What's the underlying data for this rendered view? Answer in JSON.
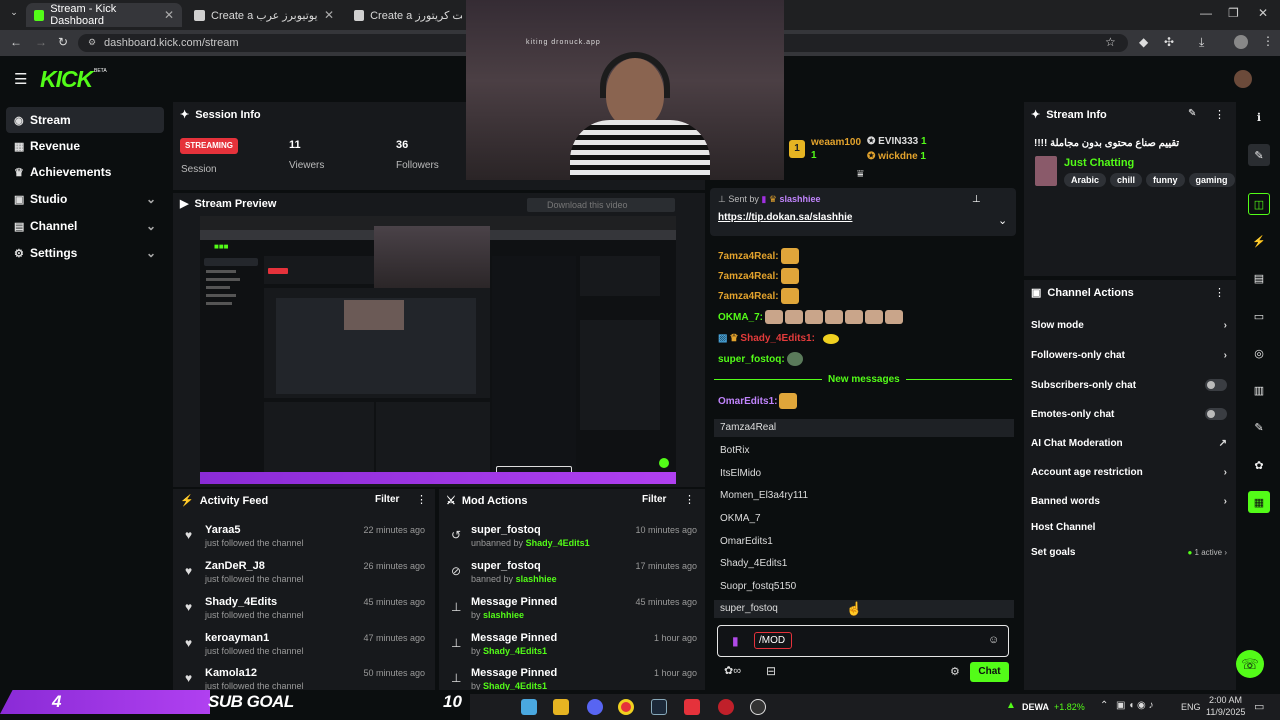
{
  "browser": {
    "tabs": [
      {
        "title": "Stream - Kick Dashboard"
      },
      {
        "title": "Create a تقييم يوتيوبرز عرب Tier"
      },
      {
        "title": "Create a كوست كريتورز Tier"
      }
    ],
    "url": "dashboard.kick.com/stream"
  },
  "brand": {
    "logo": "KICK",
    "beta": "BETA"
  },
  "sidebar": {
    "items": [
      {
        "label": "Stream"
      },
      {
        "label": "Revenue"
      },
      {
        "label": "Achievements"
      },
      {
        "label": "Studio"
      },
      {
        "label": "Channel"
      },
      {
        "label": "Settings"
      }
    ]
  },
  "session": {
    "title": "Session Info",
    "status": "STREAMING",
    "status_label": "Session",
    "viewers": "11",
    "viewers_label": "Viewers",
    "followers": "36",
    "followers_label": "Followers"
  },
  "preview": {
    "title": "Stream Preview",
    "download_label": "Download this video"
  },
  "webcam_caption": "kiting dronuck.app",
  "activity": {
    "title": "Activity Feed",
    "filter": "Filter",
    "items": [
      {
        "name": "Yaraa5",
        "sub": "just followed the channel",
        "time": "22 minutes ago"
      },
      {
        "name": "ZanDeR_J8",
        "sub": "just followed the channel",
        "time": "26 minutes ago"
      },
      {
        "name": "Shady_4Edits",
        "sub": "just followed the channel",
        "time": "45 minutes ago"
      },
      {
        "name": "keroayman1",
        "sub": "just followed the channel",
        "time": "47 minutes ago"
      },
      {
        "name": "Kamola12",
        "sub": "just followed the channel",
        "time": "50 minutes ago"
      }
    ]
  },
  "mod_actions": {
    "title": "Mod Actions",
    "filter": "Filter",
    "items": [
      {
        "name": "super_fostoq",
        "verb": "unbanned by",
        "actor": "Shady_4Edits1",
        "time": "10 minutes ago"
      },
      {
        "name": "super_fostoq",
        "verb": "banned by",
        "actor": "slashhiee",
        "time": "17 minutes ago"
      },
      {
        "name": "Message Pinned",
        "verb": "by",
        "actor": "slashhiee",
        "time": "45 minutes ago"
      },
      {
        "name": "Message Pinned",
        "verb": "by",
        "actor": "Shady_4Edits1",
        "time": "1 hour ago"
      },
      {
        "name": "Message Pinned",
        "verb": "by",
        "actor": "Shady_4Edits1",
        "time": "1 hour ago"
      }
    ]
  },
  "leaderboard": {
    "first": {
      "rank": "1",
      "name": "weaam100",
      "count": "1"
    },
    "others": [
      {
        "name": "EVIN333",
        "count": "1"
      },
      {
        "name": "wickdne",
        "count": "1"
      }
    ]
  },
  "pinned": {
    "sent_by_label": "Sent by",
    "sender": "slashhiee",
    "link": "https://tip.dokan.sa/slashhie"
  },
  "chat": {
    "messages": [
      {
        "user": "7amza4Real:",
        "color": "#e3a32d"
      },
      {
        "user": "7amza4Real:",
        "color": "#e3a32d"
      },
      {
        "user": "7amza4Real:",
        "color": "#e3a32d"
      },
      {
        "user": "OKMA_7:",
        "color": "#53fc18"
      },
      {
        "user": "Shady_4Edits1:",
        "color": "#e33b3b"
      },
      {
        "user": "super_fostoq:",
        "color": "#53fc18"
      }
    ],
    "new_messages_label": "New messages",
    "after_new": {
      "user": "OmarEdits1:",
      "color": "#c084fc"
    },
    "suggestions": [
      "7amza4Real",
      "BotRix",
      "ItsElMido",
      "Momen_El3a4ry111",
      "OKMA_7",
      "OmarEdits1",
      "Shady_4Edits1",
      "Suopr_fostq5150",
      "super_fostoq"
    ],
    "input_value": "/MOD",
    "send_label": "Chat"
  },
  "stream_info": {
    "title": "Stream Info",
    "stream_title": "تقييم صناع محتوى بدون مجاملة !!!!",
    "category": "Just Chatting",
    "tags": [
      "Arabic",
      "chill",
      "funny",
      "gaming"
    ]
  },
  "channel_actions": {
    "title": "Channel Actions",
    "items": [
      {
        "label": "Slow mode",
        "control": "chevron"
      },
      {
        "label": "Followers-only chat",
        "control": "chevron"
      },
      {
        "label": "Subscribers-only chat",
        "control": "toggle"
      },
      {
        "label": "Emotes-only chat",
        "control": "toggle"
      },
      {
        "label": "AI Chat Moderation",
        "control": "external"
      },
      {
        "label": "Account age restriction",
        "control": "chevron"
      },
      {
        "label": "Banned words",
        "control": "chevron"
      },
      {
        "label": "Host Channel",
        "control": "none"
      },
      {
        "label": "Set goals",
        "control": "active"
      }
    ],
    "goals_active": "1 active"
  },
  "sub_goal": {
    "current": "4",
    "label": "SUB GOAL",
    "target": "10"
  },
  "taskbar": {
    "ticker_symbol": "DEWA",
    "ticker_change": "+1.82%",
    "lang": "ENG",
    "time": "2:00 AM",
    "date": "11/9/2025"
  },
  "colors": {
    "accent": "#53fc18",
    "streaming": "#e5323b",
    "purple": "#a030e0"
  }
}
